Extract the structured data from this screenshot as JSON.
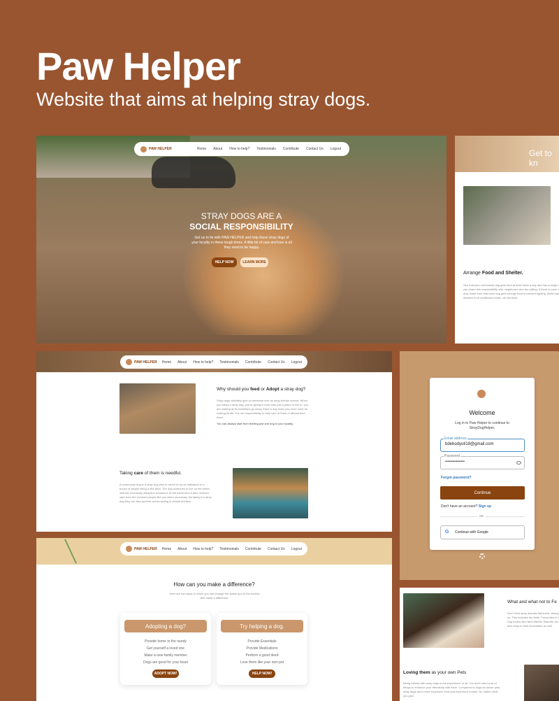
{
  "hero": {
    "title": "Paw Helper",
    "subtitle": "Website that aims at helping stray dogs."
  },
  "nav": {
    "brand": "PAW HELPER",
    "links": [
      "Home",
      "About",
      "How to help?",
      "Testimonials",
      "Contribute",
      "Contact Us",
      "Logout"
    ]
  },
  "panel1": {
    "headline_top": "STRAY DOGS ARE A",
    "headline_bottom": "SOCIAL RESPONSIBILITY",
    "body": "Get us to tie with PAW HELPER and help these stray dogs of your locality in these tough times. A little bit of care and love is all they need to be happy.",
    "help_btn": "HELP NOW",
    "learn_btn": "LEARN MORE"
  },
  "panel2": {
    "banner": "Get to kn",
    "heading_prefix": "Arrange ",
    "heading_bold": "Food and Shelter.",
    "text": "See that your community dog gets food at least twice a day and has enough water. You can share this responsibility with neighbours who are willing. If there is more than one dog, make sure that each dog gets enough food to prevent fighting. Build makeshift shelters from cardboard boxes, old furniture."
  },
  "panel3": {
    "q_prefix": "Why should you ",
    "q_bold1": "feed",
    "q_mid": " or ",
    "q_bold2": "Adopt",
    "q_suffix": " a stray dog?",
    "q_text": "Stray dogs definitely give us immense love as stray-friends forever. When you adopt a stray dog, you're giving it more than just a place to live in, you are making all its hardships go away. Each a dog loves you even more for making its life. It is our responsibility to take care of them or atleast feed them.",
    "q_highlight": "You can always start from feeding just one dog in your locality.",
    "care_prefix": "Taking ",
    "care_bold": "care",
    "care_suffix": " of them is needful.",
    "care_text": "A community dog is a stray dog who is cared for by an individual or a bunch of people living in the area. The dog continues to live on the street with the necessary discipline treatment. At the same time it also receives care from the involved people like you when necessary. By taking it a stray dog they are also prevent overcrowding in animal shelters."
  },
  "panel4": {
    "title": "How can you make a difference?",
    "subtitle": "Here are two ways in which you can change the status quo of the society and make a difference.",
    "card1": {
      "title": "Adopting a dog?",
      "items": [
        "Provide home to the needy",
        "Get yourself a loved one",
        "Make a new family member",
        "Dogs are good for your heart"
      ],
      "btn": "ADOPT NOW!"
    },
    "card2": {
      "title": "Try helping a dog.",
      "items": [
        "Provide Essentials",
        "Provide Medications",
        "Perform a good deed",
        "Love them like your own pet"
      ],
      "btn": "HELP NOW!"
    }
  },
  "login": {
    "title": "Welcome",
    "subtitle": "Log in to Paw Helper to continue to StrayDogHelper.",
    "email_label": "Email address",
    "email_value": "bdebodyuti18@gmail.com",
    "password_label": "Password",
    "password_value": "••••••••••••••••",
    "forgot": "Forgot password?",
    "continue_btn": "Continue",
    "no_account": "Don't have an account?",
    "signup": "Sign up",
    "or": "OR",
    "google": "Continue with Google"
  },
  "panel6": {
    "heading": "What and what not to Fe",
    "text": "Don't feed stray animals flavoured, strong things as. This includes dry fruits. Favourites of Indian Dog lovers who feed Marble, Biscuits, etc. It is also easy to feed chocolates as well.",
    "loving_bold": "Loving them",
    "loving_suffix": " as your own Pets",
    "loving_text": "Being friends with stray dogs is the experience of all. You don't need a lot of things to enhance your friendship with them. Compared to dogs as house pets, stray dogs don't need expensive food and expensive homes. No matter what you give"
  },
  "colors": {
    "background": "#995530",
    "accent": "#8a4410",
    "card_head": "#c9976b"
  }
}
